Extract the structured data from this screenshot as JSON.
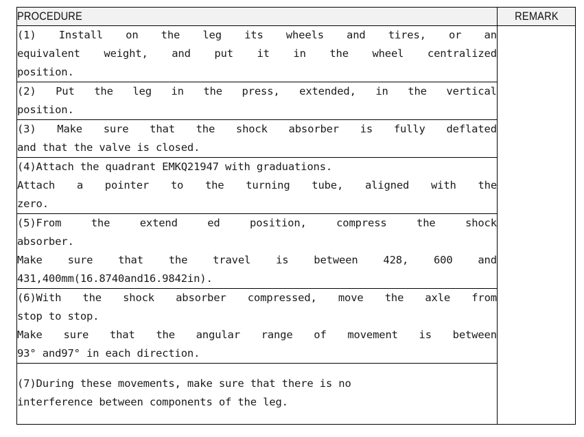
{
  "table": {
    "headers": {
      "procedure": "PROCEDURE",
      "remark": "REMARK"
    },
    "remark_cell_value": "",
    "rows": [
      {
        "id": "step-1",
        "number": "(1)",
        "lines": [
          {
            "justify": true,
            "tokens": [
              "(1)",
              "Install",
              "on",
              "the",
              "leg",
              "its",
              "wheels",
              "and",
              "tires,",
              "or",
              "an"
            ]
          },
          {
            "justify": true,
            "tokens": [
              "equivalent",
              "weight,",
              "and",
              "put",
              "it",
              "in",
              "the",
              "wheel",
              "centralized"
            ]
          },
          {
            "justify": false,
            "text": "position."
          }
        ],
        "plain_text": "(1) Install on the leg its wheels and tires, or an equivalent weight, and put it in the wheel centralized position."
      },
      {
        "id": "step-2",
        "number": "(2)",
        "lines": [
          {
            "justify": true,
            "tokens": [
              "(2)",
              "Put",
              "the",
              "leg",
              "in",
              "the",
              "press,",
              "extended,",
              "in",
              "the",
              "vertical"
            ]
          },
          {
            "justify": false,
            "text": "position."
          }
        ],
        "plain_text": "(2) Put the  leg in the press, extended, in the vertical position."
      },
      {
        "id": "step-3",
        "number": "(3)",
        "lines": [
          {
            "justify": true,
            "tokens": [
              "(3)",
              "Make",
              "sure",
              "that",
              "the",
              "shock",
              "absorber",
              "is",
              "fully",
              "deflated"
            ]
          },
          {
            "justify": false,
            "text": "and that the valve is closed."
          }
        ],
        "plain_text": "(3) Make sure  that the shock absorber is fully deflated and that the valve is closed."
      },
      {
        "id": "step-4",
        "number": "(4)",
        "lines": [
          {
            "justify": false,
            "text": "(4)Attach the quadrant EMKQ21947 with graduations."
          },
          {
            "justify": true,
            "tokens": [
              "Attach",
              "a",
              "pointer",
              "to",
              "the",
              "turning",
              "tube,",
              "aligned",
              "with",
              "the"
            ]
          },
          {
            "justify": false,
            "text": "zero."
          }
        ],
        "plain_text": "(4)Attach the quadrant EMKQ21947 with graduations. Attach a pointer to the turning tube, aligned with the zero."
      },
      {
        "id": "step-5",
        "number": "(5)",
        "lines": [
          {
            "justify": true,
            "tokens": [
              "(5)From",
              "the",
              "extend",
              "ed",
              "position,",
              "compress",
              "the",
              "shock"
            ]
          },
          {
            "justify": false,
            "text": "absorber."
          },
          {
            "justify": true,
            "tokens": [
              "Make",
              "sure",
              "that",
              "the",
              "travel",
              "is",
              "between",
              "428,",
              "600",
              "and"
            ]
          },
          {
            "justify": false,
            "text": "431,400mm(16.8740and16.9842in)."
          }
        ],
        "plain_text": "(5)From the extend ed position, compress the shock absorber. Make sure that the travel is between 428, 600 and 431,400mm(16.8740and16.9842in)."
      },
      {
        "id": "step-6",
        "number": "(6)",
        "lines": [
          {
            "justify": true,
            "tokens": [
              "(6)With",
              "the",
              "shock",
              "absorber",
              "compressed,",
              "move",
              "the",
              "axle",
              "from"
            ]
          },
          {
            "justify": false,
            "text": "stop to stop."
          },
          {
            "justify": true,
            "tokens": [
              "Make",
              "sure",
              "that",
              "the",
              "angular",
              "range",
              "of",
              "movement",
              "is",
              "between"
            ]
          },
          {
            "justify": false,
            "text": "93° and97° in each direction."
          }
        ],
        "plain_text": "(6)With the shock absorber compressed, move the axle from stop to stop. Make sure that the angular range of movement is between 93° and97° in each direction."
      },
      {
        "id": "step-7",
        "number": "(7)",
        "lines": [
          {
            "justify": false,
            "text": "(7)During these movements, make sure that there is no"
          },
          {
            "justify": false,
            "text": "interference between components of the leg."
          }
        ],
        "plain_text": "(7)During these movements, make sure that there is no interference between components of the leg."
      }
    ]
  },
  "colors": {
    "header_background": "#f2f2f2",
    "border": "#000000",
    "text": "#1a1a1a",
    "page_background": "#ffffff"
  }
}
